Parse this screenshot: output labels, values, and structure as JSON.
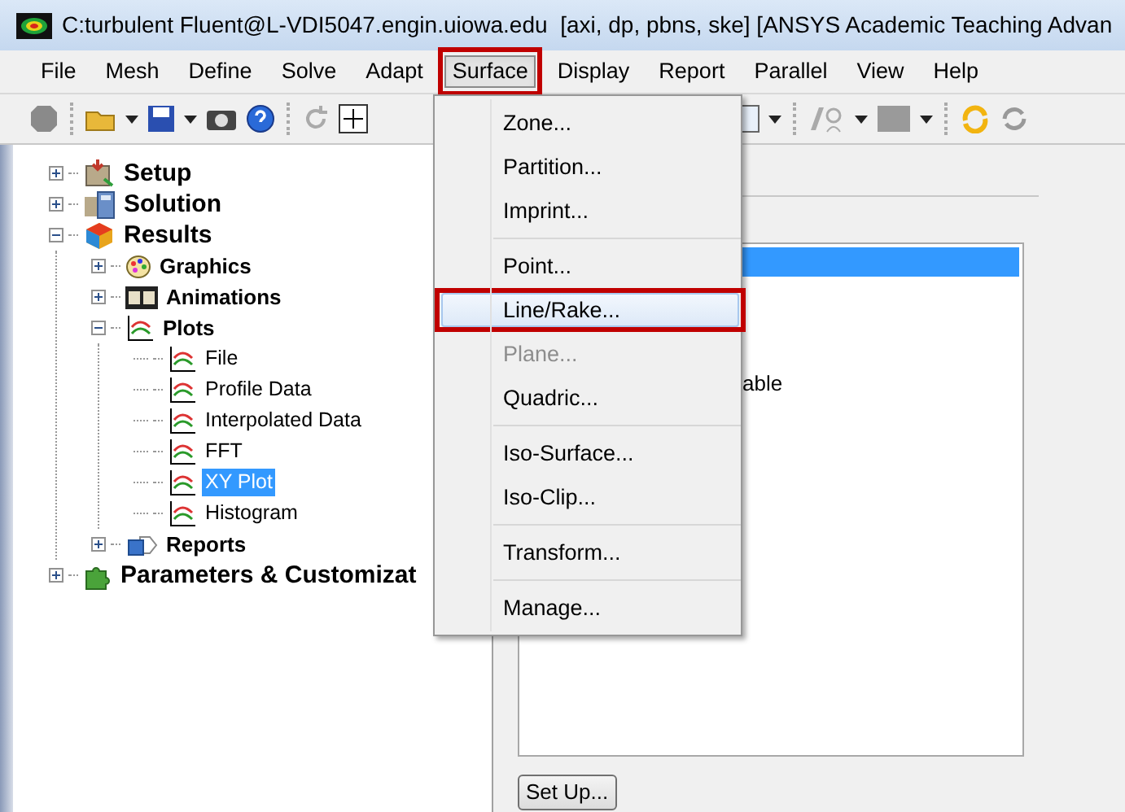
{
  "window": {
    "title": "C:turbulent Fluent@L-VDI5047.engin.uiowa.edu  [axi, dp, pbns, ske] [ANSYS Academic Teaching Advan"
  },
  "menubar": [
    {
      "label": "File",
      "selected": false,
      "annotated": false
    },
    {
      "label": "Mesh",
      "selected": false,
      "annotated": false
    },
    {
      "label": "Define",
      "selected": false,
      "annotated": false
    },
    {
      "label": "Solve",
      "selected": false,
      "annotated": false
    },
    {
      "label": "Adapt",
      "selected": false,
      "annotated": false
    },
    {
      "label": "Surface",
      "selected": true,
      "annotated": true
    },
    {
      "label": "Display",
      "selected": false,
      "annotated": false
    },
    {
      "label": "Report",
      "selected": false,
      "annotated": false
    },
    {
      "label": "Parallel",
      "selected": false,
      "annotated": false
    },
    {
      "label": "View",
      "selected": false,
      "annotated": false
    },
    {
      "label": "Help",
      "selected": false,
      "annotated": false
    }
  ],
  "menu": {
    "groups": [
      [
        {
          "label": "Zone...",
          "disabled": false,
          "selected": false,
          "annotated": false
        },
        {
          "label": "Partition...",
          "disabled": false,
          "selected": false,
          "annotated": false
        },
        {
          "label": "Imprint...",
          "disabled": false,
          "selected": false,
          "annotated": false
        }
      ],
      [
        {
          "label": "Point...",
          "disabled": false,
          "selected": false,
          "annotated": false
        },
        {
          "label": "Line/Rake...",
          "disabled": false,
          "selected": true,
          "annotated": true
        },
        {
          "label": "Plane...",
          "disabled": true,
          "selected": false,
          "annotated": false
        },
        {
          "label": "Quadric...",
          "disabled": false,
          "selected": false,
          "annotated": false
        }
      ],
      [
        {
          "label": "Iso-Surface...",
          "disabled": false,
          "selected": false,
          "annotated": false
        },
        {
          "label": "Iso-Clip...",
          "disabled": false,
          "selected": false,
          "annotated": false
        }
      ],
      [
        {
          "label": "Transform...",
          "disabled": false,
          "selected": false,
          "annotated": false
        }
      ],
      [
        {
          "label": "Manage...",
          "disabled": false,
          "selected": false,
          "annotated": false
        }
      ]
    ]
  },
  "tree": [
    {
      "label": "Setup",
      "expanded": false,
      "selected": false
    },
    {
      "label": "Solution",
      "expanded": false,
      "selected": false
    },
    {
      "label": "Results",
      "expanded": true,
      "selected": false,
      "children": [
        {
          "label": "Graphics",
          "expanded": false,
          "selected": false
        },
        {
          "label": "Animations",
          "expanded": false,
          "selected": false
        },
        {
          "label": "Plots",
          "expanded": true,
          "selected": false,
          "children": [
            {
              "label": "File",
              "selected": false
            },
            {
              "label": "Profile Data",
              "selected": false
            },
            {
              "label": "Interpolated Data",
              "selected": false
            },
            {
              "label": "FFT",
              "selected": false
            },
            {
              "label": "XY Plot",
              "selected": true
            },
            {
              "label": "Histogram",
              "selected": false
            }
          ]
        },
        {
          "label": "Reports",
          "expanded": false,
          "selected": false
        }
      ]
    },
    {
      "label": "Parameters & Customizat",
      "expanded": false,
      "selected": false
    }
  ],
  "list": {
    "rows": [
      {
        "selected": true
      },
      {
        "text": "able",
        "selected": false
      }
    ]
  },
  "buttons": [
    {
      "label": "Set Up..."
    }
  ]
}
